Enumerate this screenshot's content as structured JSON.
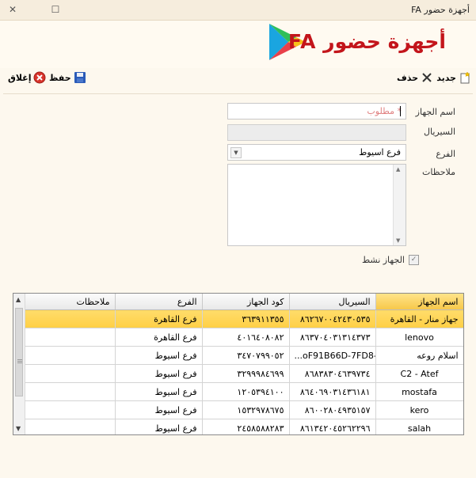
{
  "window": {
    "title": "أجهزة حضور FA"
  },
  "header": {
    "heading": "أجهزة حضور FA"
  },
  "toolbar": {
    "new_label": "جديد",
    "delete_label": "حذف",
    "save_label": "حفظ",
    "close_label": "إغلاق"
  },
  "form": {
    "device_name_label": "اسم الجهاز",
    "device_name_placeholder": "* مطلوب",
    "serial_label": "السيريال",
    "branch_label": "الفرع",
    "branch_value": "فرع اسيوط",
    "notes_label": "ملاحظات",
    "active_label": "الجهاز نشط",
    "active_checked": true
  },
  "grid": {
    "columns": [
      "اسم الجهاز",
      "السيريال",
      "كود الجهاز",
      "الفرع",
      "ملاحظات"
    ],
    "rows": [
      {
        "name": "جهاز منار - القاهرة",
        "serial": "٨٦٢٦٧٠٠٤٢٤٣٠٥٣٥",
        "code": "٣٦٣٩١١٣٥٥",
        "branch": "فرع القاهرة",
        "notes": ""
      },
      {
        "name": "lenovo",
        "serial": "٨٦٣٧٠٤٠٣١٣١٤٣٧٣",
        "code": "٤٠١٦٤٠٨٠٨٢",
        "branch": "فرع القاهرة",
        "notes": ""
      },
      {
        "name": "اسلام روعه",
        "serial": "...oF91B66D-7FD8-4",
        "code": "٣٤٧٠٧٩٩٠٥٢",
        "branch": "فرع اسيوط",
        "notes": ""
      },
      {
        "name": "C2 - Atef",
        "serial": "٨٦٨٣٨٣٠٤٦٣٩٧٣٤",
        "code": "٣٢٩٩٩٨٤٦٩٩",
        "branch": "فرع اسيوط",
        "notes": ""
      },
      {
        "name": "mostafa",
        "serial": "٨٦٤٠٦٩٠٣١٤٣٦١٨١",
        "code": "١٢٠٥٣٩٤١٠٠",
        "branch": "فرع اسيوط",
        "notes": ""
      },
      {
        "name": "kero",
        "serial": "٨٦٠٠٢٨٠٤٩٣٥١٥٧",
        "code": "١٥٣٢٩٧٨٦٧٥",
        "branch": "فرع اسيوط",
        "notes": ""
      },
      {
        "name": "salah",
        "serial": "٨٦١٣٤٢٠٤٥٢٦٢٢٩٦",
        "code": "٢٤٥٨٥٨٨٢٨٣",
        "branch": "فرع اسيوط",
        "notes": ""
      }
    ],
    "selected_index": 0
  },
  "colors": {
    "heading": "#c3151b",
    "selection": "#ffd34f",
    "background": "#fdf8ee"
  }
}
